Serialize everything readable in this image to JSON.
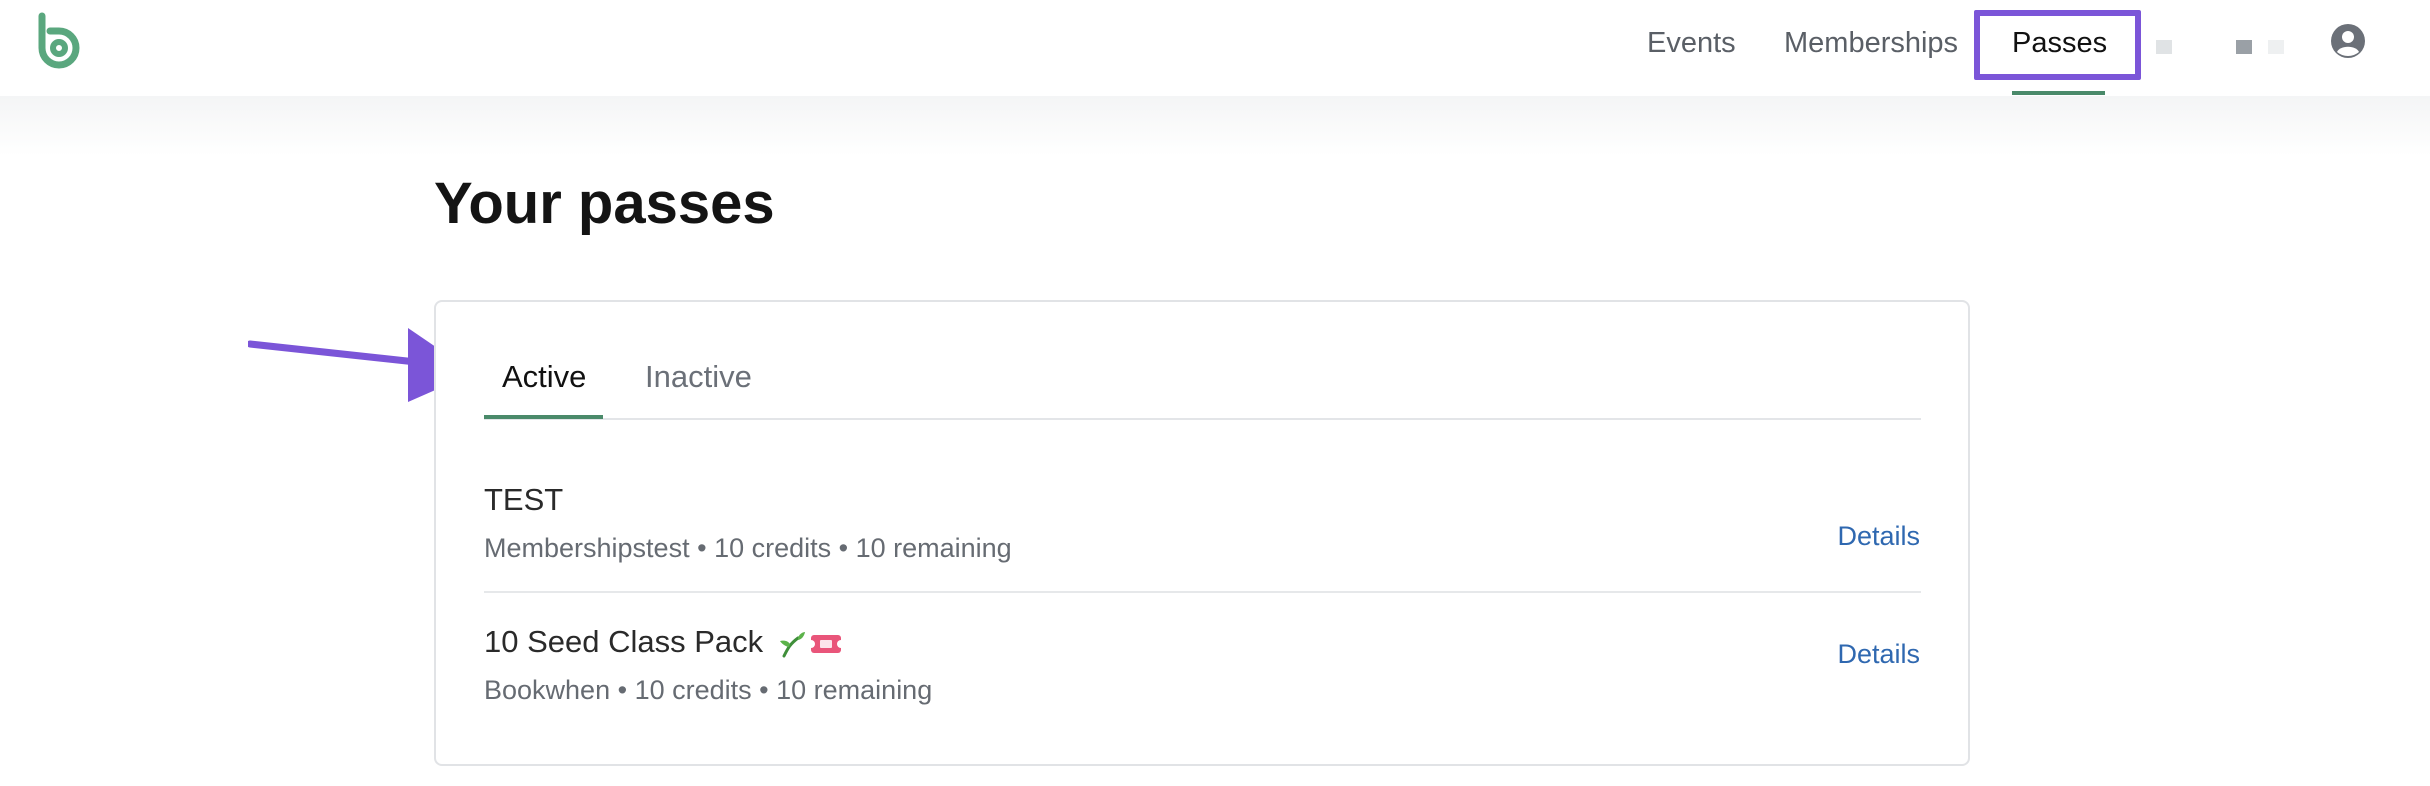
{
  "header": {
    "nav": {
      "events": "Events",
      "memberships": "Memberships",
      "passes": "Passes"
    },
    "logo_icon": "bookwhen-logo",
    "avatar_icon": "user-account-icon",
    "colors": {
      "accent": "#4a8a6a",
      "highlight": "#7b55d8"
    }
  },
  "main": {
    "title": "Your passes",
    "tabs": [
      {
        "label": "Active",
        "selected": true
      },
      {
        "label": "Inactive",
        "selected": false
      }
    ],
    "passes": [
      {
        "name": "TEST",
        "provider": "Membershipstest",
        "credits": "10 credits",
        "remaining": "10 remaining",
        "details": "Details"
      },
      {
        "name": "10 Seed Class Pack",
        "emoji": [
          "seedling",
          "ticket"
        ],
        "provider": "Bookwhen",
        "credits": "10 credits",
        "remaining": "10 remaining",
        "details": "Details"
      }
    ],
    "separator": "•"
  }
}
